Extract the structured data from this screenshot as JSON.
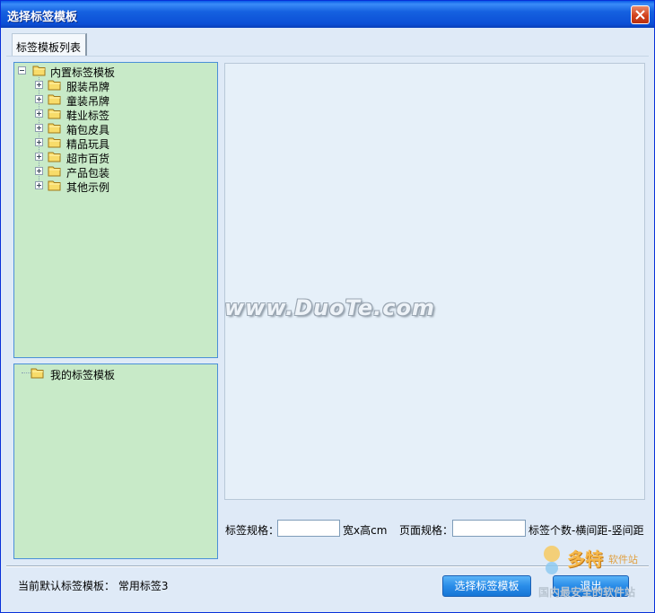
{
  "window": {
    "title": "选择标签模板"
  },
  "tabs": [
    {
      "label": "标签模板列表"
    }
  ],
  "tree_builtin": {
    "root": "内置标签模板",
    "children": [
      "服装吊牌",
      "童装吊牌",
      "鞋业标签",
      "箱包皮具",
      "精品玩具",
      "超市百货",
      "产品包装",
      "其他示例"
    ]
  },
  "tree_mine": {
    "root": "我的标签模板"
  },
  "preview": {
    "watermark": "www.DuoTe.com"
  },
  "spec": {
    "label_spec": "标签规格：",
    "label_spec_value": "",
    "label_unit": "宽x高cm",
    "page_spec": "页面规格：",
    "page_spec_value": "",
    "page_hint": "标签个数-横间距-竖间距"
  },
  "footer": {
    "current_default": "当前默认标签模板：  常用标签3",
    "select_button": "选择标签模板",
    "exit_button": "退出"
  },
  "logo": {
    "line1": "多特",
    "line2": "软件站",
    "line3": "国内最安全的软件站"
  },
  "colors": {
    "titlebar": "#0c4fd6",
    "panel": "#c8eac8",
    "button": "#2a8ce8",
    "background": "#dfeaf7"
  }
}
